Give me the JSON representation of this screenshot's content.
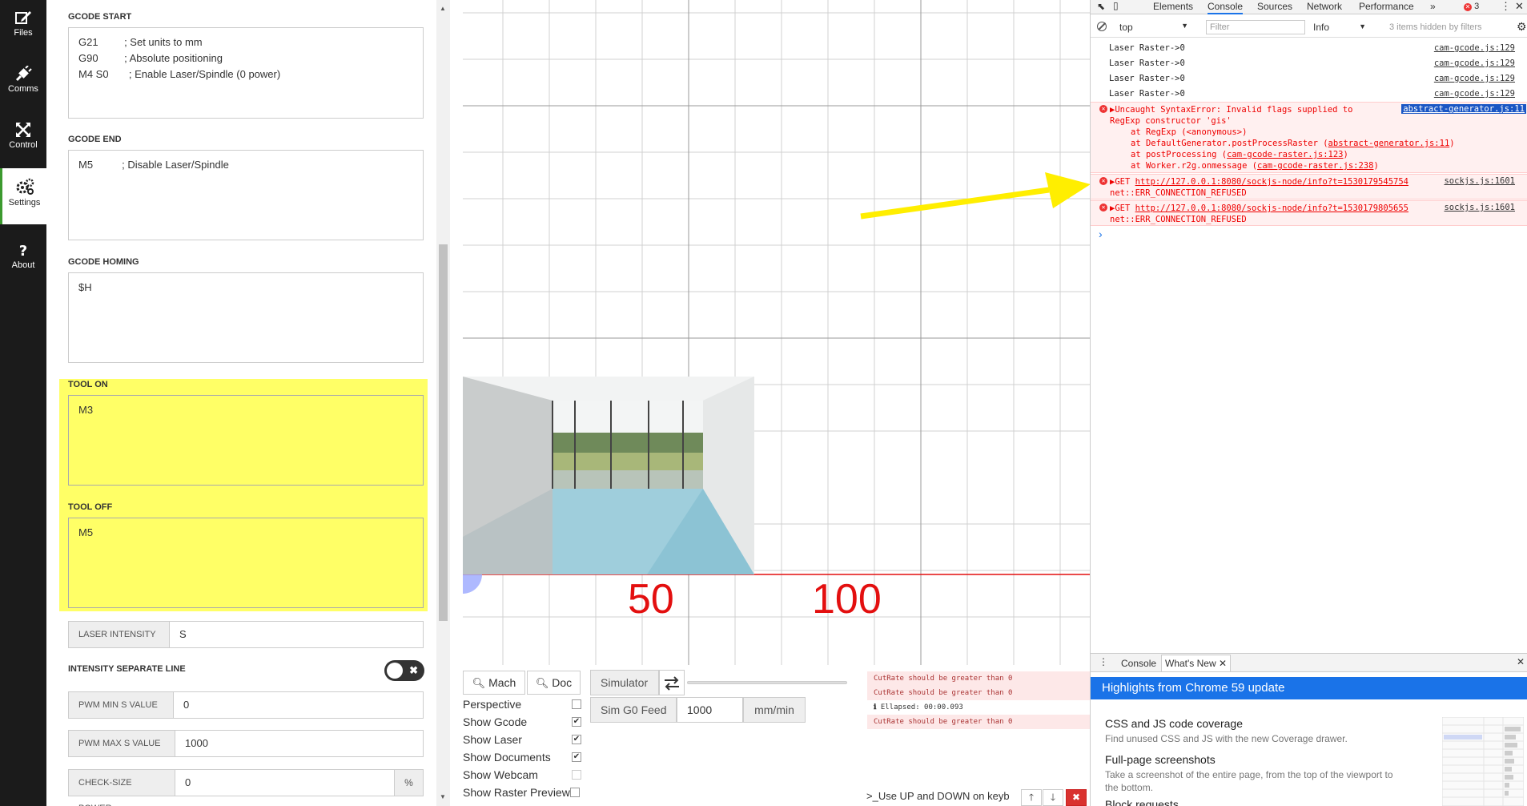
{
  "nav": {
    "items": [
      {
        "label": "Files",
        "icon": "edit-icon"
      },
      {
        "label": "Comms",
        "icon": "plug-icon"
      },
      {
        "label": "Control",
        "icon": "arrows-icon"
      },
      {
        "label": "Settings",
        "icon": "gears-icon"
      },
      {
        "label": "About",
        "icon": "question-icon"
      }
    ]
  },
  "settings": {
    "gcode_start": {
      "label": "GCODE START",
      "value": "G21         ; Set units to mm\nG90         ; Absolute positioning\nM4 S0       ; Enable Laser/Spindle (0 power)"
    },
    "gcode_end": {
      "label": "GCODE END",
      "value": "M5          ; Disable Laser/Spindle"
    },
    "gcode_homing": {
      "label": "GCODE HOMING",
      "value": "$H"
    },
    "tool_on": {
      "label": "TOOL ON",
      "value": "M3"
    },
    "tool_off": {
      "label": "TOOL OFF",
      "value": "M5"
    },
    "laser_intensity": {
      "label": "LASER INTENSITY",
      "value": "S"
    },
    "intensity_separate_line": {
      "label": "INTENSITY SEPARATE LINE",
      "toggle_symbol": "✖"
    },
    "pwm_min": {
      "label": "PWM MIN S VALUE",
      "value": "0"
    },
    "pwm_max": {
      "label": "PWM MAX S VALUE",
      "value": "1000"
    },
    "check_size_power": {
      "label": "CHECK-SIZE POWER",
      "value": "0",
      "suffix": "%"
    }
  },
  "viewer": {
    "axis_labels": [
      "50",
      "100"
    ]
  },
  "controls": {
    "mach_label": "Mach",
    "doc_label": "Doc",
    "simulator_label": "Simulator",
    "sim_g0_feed_label": "Sim G0 Feed",
    "sim_g0_feed_value": "1000",
    "sim_g0_feed_unit": "mm/min",
    "checkboxes": [
      {
        "label": "Perspective",
        "checked": false
      },
      {
        "label": "Show Gcode",
        "checked": true
      },
      {
        "label": "Show Laser",
        "checked": true
      },
      {
        "label": "Show Documents",
        "checked": true
      },
      {
        "label": "Show Webcam",
        "checked": false
      },
      {
        "label": "Show Raster Preview",
        "checked": false
      }
    ],
    "log": [
      {
        "text": "CutRate should be greater than 0",
        "type": "err"
      },
      {
        "text": "CutRate should be greater than 0",
        "type": "err"
      },
      {
        "text": "Ellapsed: 00:00.093",
        "type": "info"
      },
      {
        "text": "CutRate should be greater than 0",
        "type": "err"
      }
    ],
    "hint_text": ">_Use UP and DOWN on keyb"
  },
  "devtools": {
    "tabs": [
      "Elements",
      "Console",
      "Sources",
      "Network",
      "Performance"
    ],
    "more_tabs": "»",
    "error_count": "3",
    "context": "top",
    "filter_placeholder": "Filter",
    "level": "Info",
    "hidden_note": "3 items hidden by filters",
    "logs": [
      {
        "text": "Laser Raster->0",
        "src": "cam-gcode.js:129"
      },
      {
        "text": "Laser Raster->0",
        "src": "cam-gcode.js:129"
      },
      {
        "text": "Laser Raster->0",
        "src": "cam-gcode.js:129"
      },
      {
        "text": "Laser Raster->0",
        "src": "cam-gcode.js:129"
      }
    ],
    "error1": {
      "line1": "Uncaught SyntaxError: Invalid flags supplied to",
      "src": "abstract-generator.js:11",
      "line2": "RegExp constructor 'gis'",
      "stack": [
        {
          "fn": "at RegExp (<anonymous>)",
          "link": ""
        },
        {
          "fn": "at DefaultGenerator.postProcessRaster (",
          "link": "abstract-generator.js:11",
          "tail": ")"
        },
        {
          "fn": "at postProcessing (",
          "link": "cam-gcode-raster.js:123",
          "tail": ")"
        },
        {
          "fn": "at Worker.r2g.onmessage (",
          "link": "cam-gcode-raster.js:238",
          "tail": ")"
        }
      ]
    },
    "error2": {
      "prefix": "GET",
      "url": "http://127.0.0.1:8080/sockjs-node/info?t=1530179545754",
      "src": "sockjs.js:1601",
      "msg": "net::ERR_CONNECTION_REFUSED"
    },
    "error3": {
      "prefix": "GET",
      "url": "http://127.0.0.1:8080/sockjs-node/info?t=1530179805655",
      "src": "sockjs.js:1601",
      "msg": "net::ERR_CONNECTION_REFUSED"
    },
    "prompt": "›",
    "drawer": {
      "tabs": [
        "Console",
        "What's New"
      ],
      "header": "Highlights from Chrome 59 update",
      "items": [
        {
          "title": "CSS and JS code coverage",
          "desc": "Find unused CSS and JS with the new Coverage drawer."
        },
        {
          "title": "Full-page screenshots",
          "desc": "Take a screenshot of the entire page, from the top of the viewport to the bottom."
        },
        {
          "title": "Block requests",
          "desc": ""
        }
      ]
    }
  },
  "colors": {
    "highlight": "#ffff66",
    "axis_red": "#e30f0f",
    "devtools_blue": "#1a73e8",
    "arrow_yellow": "#ffee00"
  }
}
